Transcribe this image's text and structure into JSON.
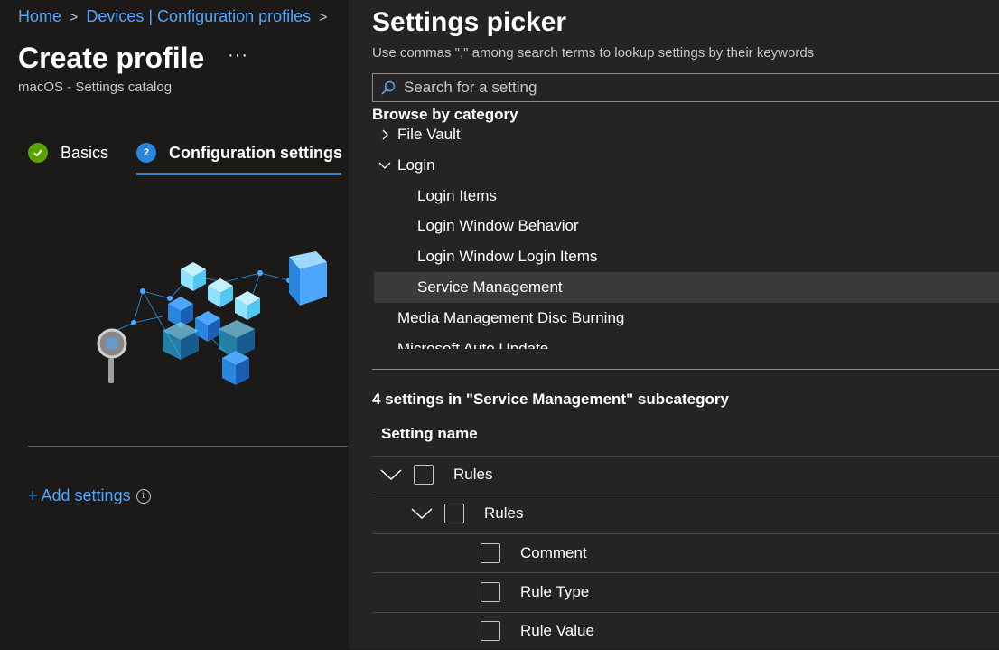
{
  "breadcrumb": {
    "home": "Home",
    "devices": "Devices | Configuration profiles"
  },
  "page": {
    "title": "Create profile",
    "more": "···",
    "subtitle": "macOS - Settings catalog"
  },
  "steps": [
    {
      "label": "Basics",
      "state": "complete"
    },
    {
      "number": "2",
      "label": "Configuration settings",
      "state": "current"
    }
  ],
  "add_settings": {
    "label": "+ Add settings"
  },
  "picker": {
    "title": "Settings picker",
    "hint": "Use commas \",\" among search terms to lookup settings by their keywords",
    "search_placeholder": "Search for a setting",
    "browse_label": "Browse by category",
    "categories": [
      {
        "label": "File Vault",
        "expanded": false
      },
      {
        "label": "Login",
        "expanded": true
      },
      {
        "label": "Login Items"
      },
      {
        "label": "Login Window Behavior"
      },
      {
        "label": "Login Window Login Items"
      },
      {
        "label": "Service Management",
        "selected": true
      },
      {
        "label": "Media Management Disc Burning"
      },
      {
        "label": "Microsoft Auto Update"
      }
    ],
    "results_label": "4 settings in \"Service Management\" subcategory",
    "column_header": "Setting name",
    "settings": [
      {
        "label": "Rules",
        "level": 0,
        "expandable": true,
        "checked": false
      },
      {
        "label": "Rules",
        "level": 1,
        "expandable": true,
        "checked": false
      },
      {
        "label": "Comment",
        "level": 2,
        "checked": false
      },
      {
        "label": "Rule Type",
        "level": 2,
        "checked": false
      },
      {
        "label": "Rule Value",
        "level": 2,
        "checked": false
      }
    ]
  },
  "colors": {
    "accent": "#2886de",
    "link": "#4ea7ff",
    "success": "#57a300",
    "panel": "#252423",
    "background": "#1b1a19"
  }
}
